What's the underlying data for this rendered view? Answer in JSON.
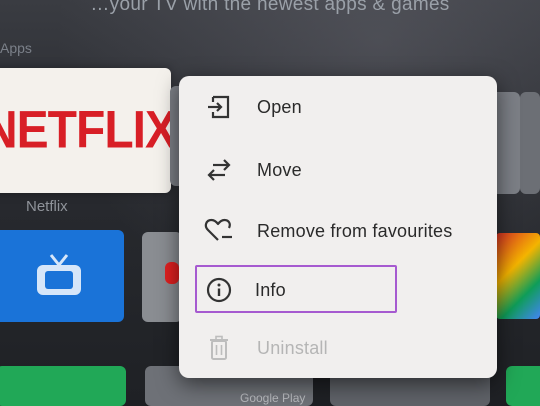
{
  "banner": {
    "text": "…your TV with the newest apps & games"
  },
  "row_label": "Apps",
  "netflix_tile": {
    "logo": "NETFLIX",
    "caption": "Netflix"
  },
  "other_tiles": {
    "google_play_text": "Google Play"
  },
  "menu": {
    "items": [
      {
        "label": "Open",
        "icon": "open-in-icon",
        "enabled": true
      },
      {
        "label": "Move",
        "icon": "swap-arrows-icon",
        "enabled": true
      },
      {
        "label": "Remove from favourites",
        "icon": "heart-remove-icon",
        "enabled": true
      },
      {
        "label": "Info",
        "icon": "info-icon",
        "enabled": true,
        "focused": true
      },
      {
        "label": "Uninstall",
        "icon": "trash-icon",
        "enabled": false
      }
    ]
  },
  "colors": {
    "focus_outline": "#a65ad0",
    "netflix_red": "#d81f26",
    "menu_bg": "#f1efee"
  }
}
